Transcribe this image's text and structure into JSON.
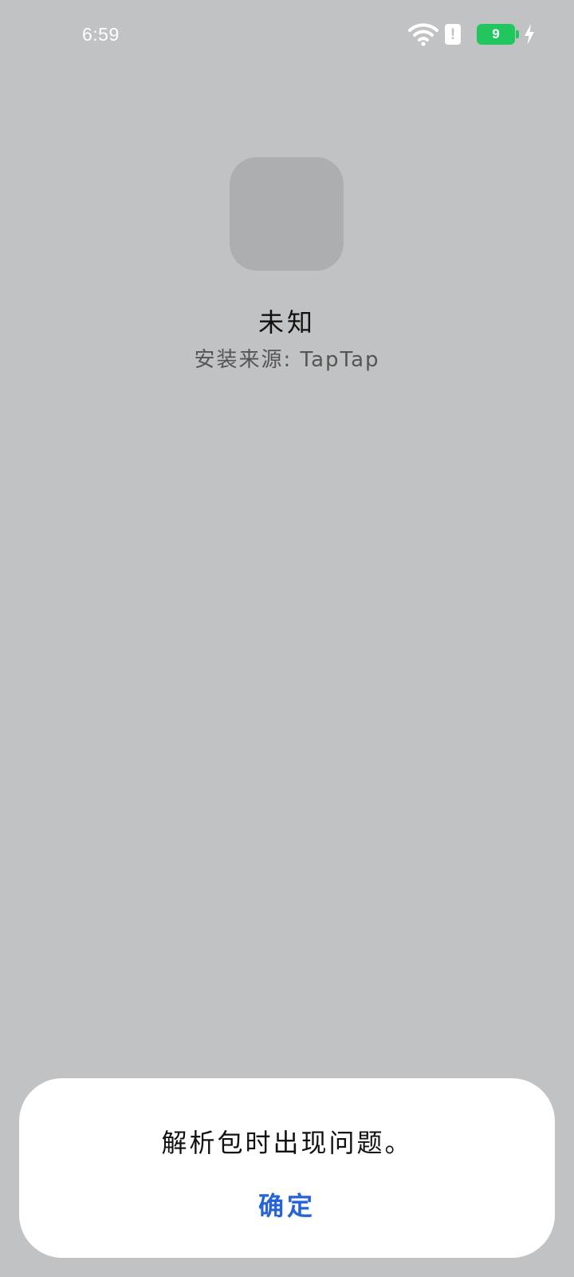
{
  "status_bar": {
    "time": "6:59",
    "battery_level": "9",
    "alert_glyph": "!",
    "icons": [
      "wifi-icon",
      "alert-icon",
      "battery-icon",
      "charging-icon"
    ],
    "battery_color": "#22c55e"
  },
  "app": {
    "name": "未知",
    "install_source": "安装来源: TapTap",
    "icon_placeholder_color": "#adaeb0"
  },
  "dialog": {
    "message": "解析包时出现问题。",
    "confirm_label": "确定",
    "accent_color": "#2563d6"
  }
}
